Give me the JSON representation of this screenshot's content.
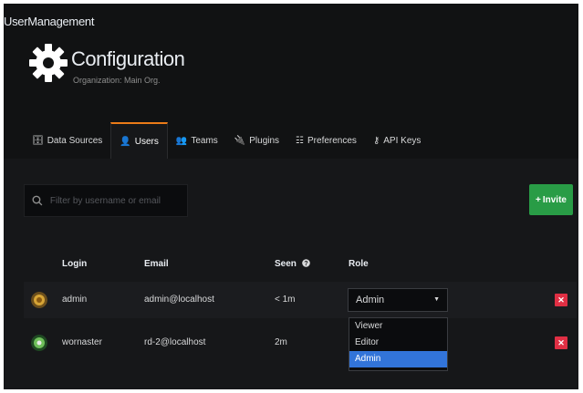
{
  "window": {
    "title": "UserManagement"
  },
  "page": {
    "title": "Configuration",
    "subtitle": "Organization: Main Org."
  },
  "tabs": [
    {
      "label": "Data Sources",
      "icon": "database-icon",
      "glyph": "🗄"
    },
    {
      "label": "Users",
      "icon": "user-icon",
      "glyph": "👤",
      "active": true
    },
    {
      "label": "Teams",
      "icon": "users-icon",
      "glyph": "👥"
    },
    {
      "label": "Plugins",
      "icon": "plug-icon",
      "glyph": "🔌"
    },
    {
      "label": "Preferences",
      "icon": "sliders-icon",
      "glyph": "☷"
    },
    {
      "label": "API Keys",
      "icon": "key-icon",
      "glyph": "⚷"
    }
  ],
  "search": {
    "placeholder": "Filter by username or email"
  },
  "invite_button": {
    "label": "Invite",
    "icon": "plus-icon"
  },
  "table": {
    "columns": {
      "login": "Login",
      "email": "Email",
      "seen": "Seen",
      "role": "Role"
    },
    "rows": [
      {
        "login": "admin",
        "email": "admin@localhost",
        "seen": "< 1m",
        "role": "Admin"
      },
      {
        "login": "wornaster",
        "email": "rd-2@localhost",
        "seen": "2m",
        "role": ""
      }
    ]
  },
  "role_dropdown": {
    "options": [
      "Viewer",
      "Editor",
      "Admin"
    ],
    "selected": "Admin"
  },
  "colors": {
    "accent_tab": "#eb7b18",
    "invite_green": "#299c46",
    "delete_red": "#e02f44",
    "selected_blue": "#3274d9",
    "background": "#161719"
  }
}
